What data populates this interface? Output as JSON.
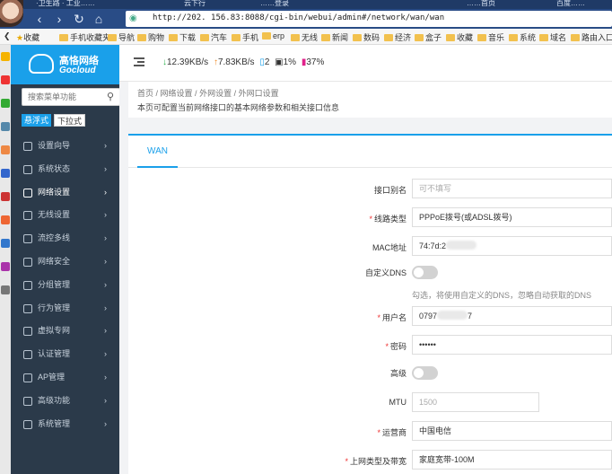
{
  "browser": {
    "tabs": [
      "·卫生路 · 工业……",
      "云下行",
      "……登录",
      "……首页",
      "百度……"
    ],
    "url": "http://202.  156.83:8088/cgi-bin/webui/admin#/network/wan/wan",
    "bookmarks": [
      "收藏",
      "手机收藏夹",
      "导航",
      "购物",
      "下载",
      "汽车",
      "手机",
      "erp",
      "无线",
      "新闻",
      "数码",
      "经济",
      "盒子",
      "收藏",
      "音乐",
      "系统",
      "域名",
      "路由入口"
    ]
  },
  "brand": {
    "cn": "高恪网络",
    "en": "Gocloud"
  },
  "sidebar": {
    "search_placeholder": "搜索菜单功能",
    "mode_float": "悬浮式",
    "mode_dropdown": "下拉式",
    "items": [
      {
        "label": "设置向导",
        "icon": "wizard-icon"
      },
      {
        "label": "系统状态",
        "icon": "status-icon"
      },
      {
        "label": "网络设置",
        "icon": "network-icon"
      },
      {
        "label": "无线设置",
        "icon": "wifi-icon"
      },
      {
        "label": "流控多线",
        "icon": "flow-icon"
      },
      {
        "label": "网络安全",
        "icon": "shield-icon"
      },
      {
        "label": "分组管理",
        "icon": "group-icon"
      },
      {
        "label": "行为管理",
        "icon": "filter-icon"
      },
      {
        "label": "虚拟专网",
        "icon": "vpn-icon"
      },
      {
        "label": "认证管理",
        "icon": "auth-icon"
      },
      {
        "label": "AP管理",
        "icon": "ap-icon"
      },
      {
        "label": "高级功能",
        "icon": "advanced-icon"
      },
      {
        "label": "系统管理",
        "icon": "gear-icon"
      }
    ]
  },
  "stats": {
    "down": "12.39KB/s",
    "up": "7.83KB/s",
    "phones": "2",
    "cpu": "1%",
    "mem": "37%"
  },
  "breadcrumb": [
    "首页",
    "网络设置",
    "外网设置",
    "外网口设置"
  ],
  "page_desc": "本页可配置当前网络接口的基本网络参数和相关接口信息",
  "tab": "WAN",
  "form": {
    "alias_label": "接口别名",
    "alias_placeholder": "可不填写",
    "linetype_label": "线路类型",
    "linetype_value": "PPPoE拨号(或ADSL拨号)",
    "mac_label": "MAC地址",
    "mac_value": "74:7d:2",
    "dns_label": "自定义DNS",
    "dns_hint": "勾选，将使用自定义的DNS，忽略自动获取的DNS",
    "user_label": "用户名",
    "user_prefix": "0797",
    "user_suffix": "7",
    "pass_label": "密码",
    "pass_value": "••••••",
    "adv_label": "高级",
    "mtu_label": "MTU",
    "mtu_placeholder": "1500",
    "isp_label": "运营商",
    "isp_value": "中国电信",
    "bw_label": "上网类型及带宽",
    "bw_value": "家庭宽带-100M"
  }
}
